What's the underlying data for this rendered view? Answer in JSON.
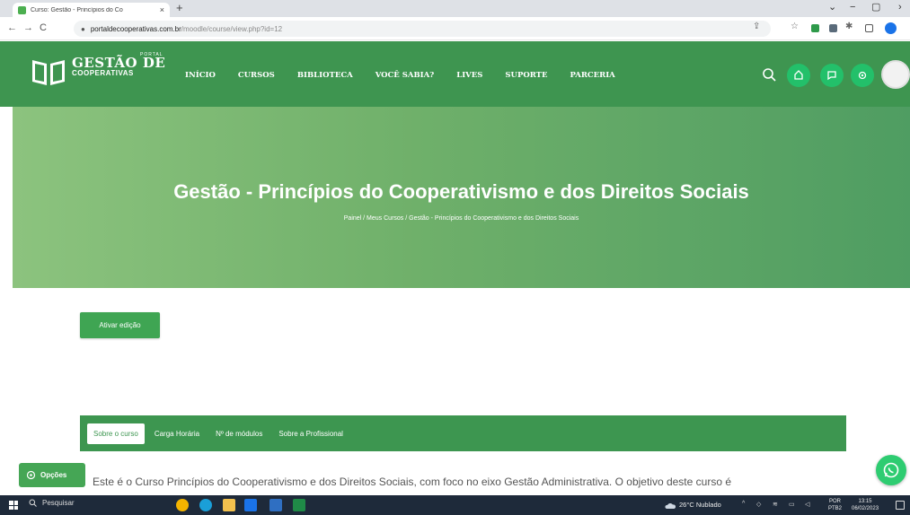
{
  "browser": {
    "tab_title": "Curso: Gestão - Princípios do Co",
    "tab_close": "×",
    "new_tab": "+",
    "url_domain": "portaldecooperativas.com.br",
    "url_path": "/moodle/course/view.php?id=12",
    "window_controls": [
      "⌄",
      "−",
      "▢",
      "›"
    ]
  },
  "header": {
    "logo_small": "PORTAL",
    "logo_main": "GESTÃO DE",
    "logo_sub": "COOPERATIVAS",
    "menu": [
      "INÍCIO",
      "CURSOS",
      "BIBLIOTECA",
      "VOCÊ SABIA?",
      "LIVES",
      "SUPORTE",
      "PARCERIA"
    ],
    "accent_color": "#3e9550",
    "icon_circle_color": "#23c06a"
  },
  "hero": {
    "title": "Gestão - Princípios do Cooperativismo e dos Direitos Sociais",
    "breadcrumb": "Painel  /  Meus Cursos  /  Gestão - Princípios do Cooperativismo e dos Direitos Sociais"
  },
  "main": {
    "edit_button": "Ativar edição",
    "tabs": [
      "Sobre o curso",
      "Carga Horária",
      "Nº de módulos",
      "Sobre a Profissional"
    ],
    "active_tab": "Sobre o curso",
    "body_text": "Este é o Curso Princípios do Cooperativismo e dos Direitos Sociais, com foco no eixo Gestão Administrativa. O objetivo deste curso é",
    "options_button": "Opções",
    "whatsapp_icon": "whatsapp-icon"
  },
  "taskbar": {
    "search_label": "Pesquisar",
    "weather": "26°C  Nublado",
    "lang_line1": "POR",
    "lang_line2": "PTB2",
    "time": "13:15",
    "date": "06/02/2023"
  }
}
